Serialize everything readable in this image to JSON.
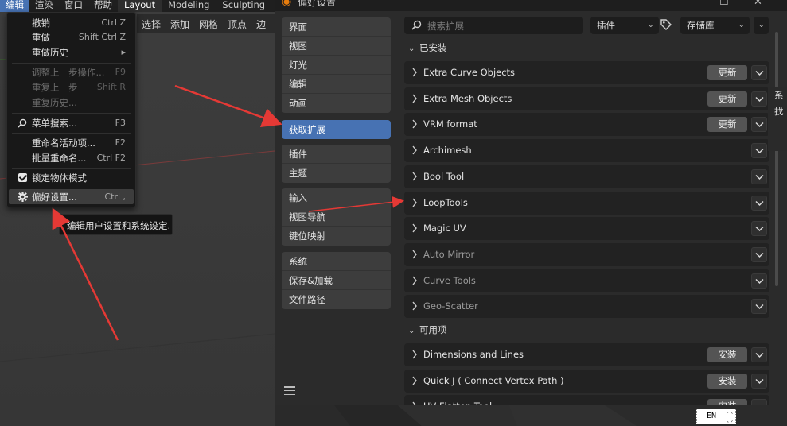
{
  "topbar": {
    "menus": [
      "编辑",
      "渲染",
      "窗口",
      "帮助"
    ],
    "workspaces": [
      "Layout",
      "Modeling",
      "Sculpting"
    ]
  },
  "viewport_header": [
    "选择",
    "添加",
    "网格",
    "顶点",
    "边"
  ],
  "edit_menu": {
    "items": [
      {
        "label": "撤销",
        "shortcut": "Ctrl Z"
      },
      {
        "label": "重做",
        "shortcut": "Shift Ctrl Z"
      },
      {
        "label": "重做历史",
        "submenu_arrow": "▸"
      },
      {
        "label": "调整上一步操作...",
        "shortcut": "F9"
      },
      {
        "label": "重复上一步",
        "shortcut": "Shift R"
      },
      {
        "label": "重复历史..."
      },
      {
        "label": "菜单搜索...",
        "shortcut": "F3"
      },
      {
        "label": "重命名活动项...",
        "shortcut": "F2"
      },
      {
        "label": "批量重命名...",
        "shortcut": "Ctrl F2"
      },
      {
        "label": "锁定物体模式"
      },
      {
        "label": "偏好设置...",
        "shortcut": "Ctrl ,"
      }
    ],
    "tooltip": "编辑用户设置和系统设定."
  },
  "preferences": {
    "title": "偏好设置",
    "sidebar_groups": [
      [
        "界面",
        "视图",
        "灯光",
        "编辑",
        "动画"
      ],
      [
        "获取扩展"
      ],
      [
        "插件",
        "主题"
      ],
      [
        "输入",
        "视图导航",
        "键位映射"
      ],
      [
        "系统",
        "保存&加载",
        "文件路径"
      ]
    ],
    "selected_item": "获取扩展",
    "search_placeholder": "搜索扩展",
    "filter_type": "插件",
    "repository": "存储库",
    "installed_label": "已安装",
    "available_label": "可用项",
    "update_label": "更新",
    "install_label": "安装",
    "installed": [
      {
        "name": "Extra Curve Objects",
        "update": true,
        "dim": false
      },
      {
        "name": "Extra Mesh Objects",
        "update": true,
        "dim": false
      },
      {
        "name": "VRM format",
        "update": true,
        "dim": false
      },
      {
        "name": "Archimesh",
        "update": false,
        "dim": false
      },
      {
        "name": "Bool Tool",
        "update": false,
        "dim": false
      },
      {
        "name": "LoopTools",
        "update": false,
        "dim": false
      },
      {
        "name": "Magic UV",
        "update": false,
        "dim": false
      },
      {
        "name": "Auto Mirror",
        "update": false,
        "dim": true
      },
      {
        "name": "Curve Tools",
        "update": false,
        "dim": true
      },
      {
        "name": "Geo-Scatter",
        "update": false,
        "dim": true
      }
    ],
    "available": [
      {
        "name": "Dimensions and Lines"
      },
      {
        "name": "Quick J ( Connect Vertex Path )"
      },
      {
        "name": "UV Flatten Tool"
      }
    ]
  },
  "right_panel_chars": [
    "系",
    "找"
  ],
  "ime": {
    "lang": "EN"
  },
  "colors": {
    "accent": "#4772b3",
    "annotation_arrow": "#e53935",
    "blender_logo": "#e87d0d"
  }
}
